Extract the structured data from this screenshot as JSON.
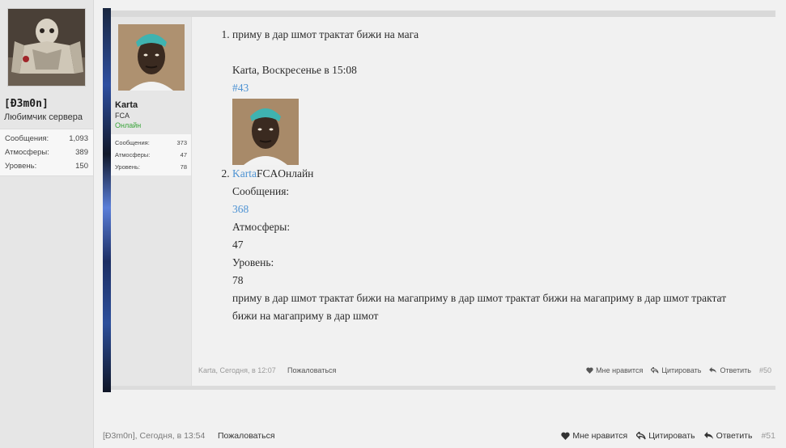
{
  "outer_post": {
    "author": {
      "name": "[Ð3m0n]",
      "title": "Любимчик сервера",
      "stats": [
        {
          "label": "Сообщения:",
          "value": "1,093"
        },
        {
          "label": "Атмосферы:",
          "value": "389"
        },
        {
          "label": "Уровень:",
          "value": "150"
        }
      ]
    },
    "footer": {
      "meta": "[Ð3m0n], Сегодня, в 13:54",
      "report": "Пожаловаться",
      "like": "Мне нравится",
      "quote": "Цитировать",
      "reply": "Ответить",
      "postnum": "#51"
    }
  },
  "inner_post": {
    "author": {
      "name": "Karta",
      "title": "FCA",
      "online": "Онлайн",
      "stats": [
        {
          "label": "Сообщения:",
          "value": "373"
        },
        {
          "label": "Атмосферы:",
          "value": "47"
        },
        {
          "label": "Уровень:",
          "value": "78"
        }
      ]
    },
    "content": {
      "item1": "приму в дар шмот трактат бижи на мага",
      "quote_meta": "Karta, Воскресенье в 15:08",
      "quote_link": "#43",
      "quoted_name": "Karta",
      "quoted_title_online": "FCAОнлайн",
      "quoted_msgs_label": "Сообщения:",
      "quoted_msgs_value": "368",
      "quoted_atm_label": "Атмосферы:",
      "quoted_atm_value": "47",
      "quoted_lvl_label": "Уровень:",
      "quoted_lvl_value": "78",
      "quoted_body": "приму в дар шмот трактат бижи на магаприму в дар шмот трактат бижи на магаприму в дар шмот трактат бижи на магаприму в дар шмот"
    },
    "footer": {
      "meta": "Karta, Сегодня, в 12:07",
      "report": "Пожаловаться",
      "like": "Мне нравится",
      "quote": "Цитировать",
      "reply": "Ответить",
      "postnum": "#50"
    }
  },
  "icons": {
    "like": "heart-icon",
    "quote": "quote-arrow-icon",
    "reply": "reply-arrow-icon"
  },
  "colors": {
    "link": "#4e93d3",
    "online": "#3aa43a",
    "sidebar": "#e6e6e6"
  }
}
